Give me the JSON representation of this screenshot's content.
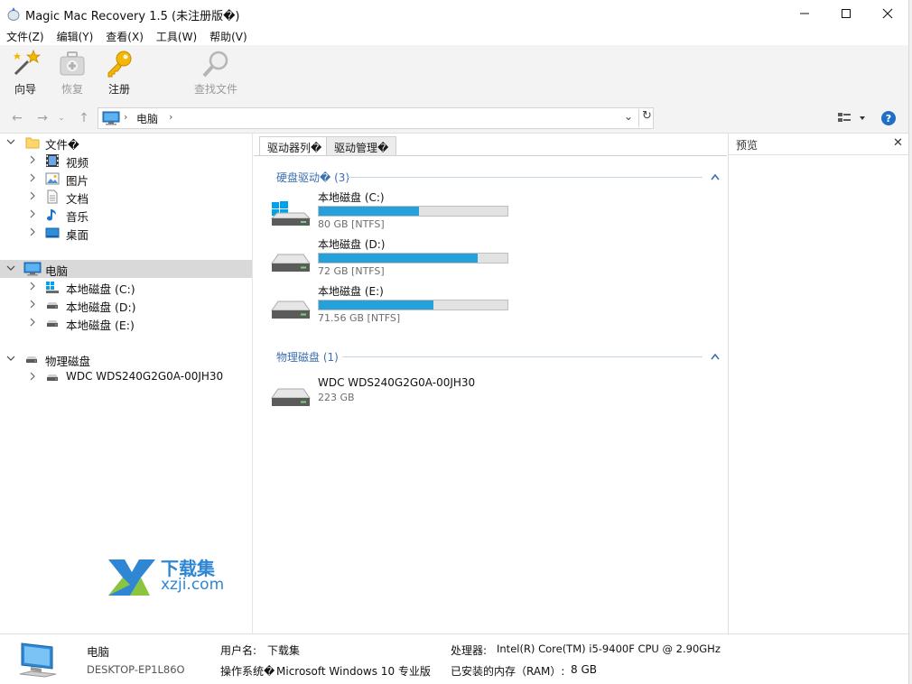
{
  "window": {
    "title": "Magic Mac Recovery 1.5 (未注册版�)"
  },
  "menu": [
    "文件(Z)",
    "编辑(Y)",
    "查看(X)",
    "工具(W)",
    "帮助(V)"
  ],
  "toolbar": {
    "wizard": "向导",
    "recover": "恢复",
    "register": "注册",
    "find_file": "查找文件"
  },
  "address": {
    "location": "电脑"
  },
  "tree": {
    "files_root": "文件�",
    "videos": "视频",
    "pictures": "图片",
    "documents": "文档",
    "music": "音乐",
    "desktop": "桌面",
    "computer": "电脑",
    "disk_c": "本地磁盘 (C:)",
    "disk_d": "本地磁盘 (D:)",
    "disk_e": "本地磁盘 (E:)",
    "physical_root": "物理磁盘",
    "physical_disk": "WDC WDS240G2G0A-00JH30"
  },
  "tabs": {
    "drive_list": "驱动器列�",
    "drive_manager": "驱动管理�"
  },
  "groups": {
    "hard_drives": "硬盘驱动� (3)",
    "physical_disks": "物理磁盘 (1)"
  },
  "drives": [
    {
      "name": "本地磁盘 (C:)",
      "size": "80 GB [NTFS]",
      "used_fraction": 0.53
    },
    {
      "name": "本地磁盘 (D:)",
      "size": "72 GB [NTFS]",
      "used_fraction": 0.84
    },
    {
      "name": "本地磁盘 (E:)",
      "size": "71.56 GB [NTFS]",
      "used_fraction": 0.61
    }
  ],
  "physical": {
    "name": "WDC WDS240G2G0A-00JH30",
    "size": "223 GB"
  },
  "watermark": {
    "cn": "下载集",
    "en": "xzji.com"
  },
  "preview": {
    "title": "预览"
  },
  "status": {
    "computer_label": "电脑",
    "computer_name": "DESKTOP-EP1L86O",
    "username_label": "用户名:",
    "username": "下载集",
    "os_label": "操作系统�",
    "os": "Microsoft Windows 10 专业版",
    "cpu_label": "处理器:",
    "cpu": "Intel(R) Core(TM) i5-9400F CPU @ 2.90GHz",
    "ram_label": "已安装的内存（RAM）:",
    "ram": "8 GB"
  },
  "colors": {
    "accent": "#26a0da",
    "group_header": "#3b6fb0",
    "selection": "#d9d9d9"
  }
}
